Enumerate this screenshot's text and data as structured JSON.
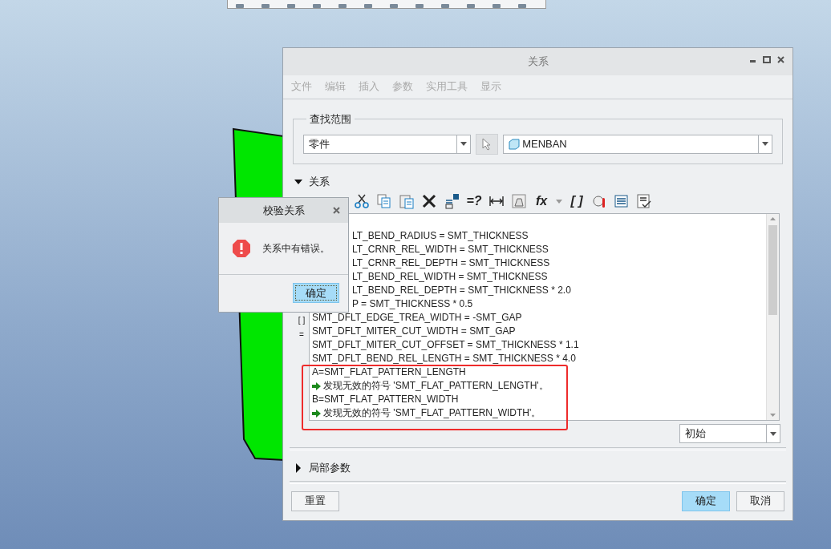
{
  "main_window": {
    "title": "关系",
    "menu": [
      {
        "label": "文件",
        "disabled": true
      },
      {
        "label": "编辑",
        "disabled": true
      },
      {
        "label": "插入",
        "disabled": true
      },
      {
        "label": "参数",
        "disabled": true
      },
      {
        "label": "实用工具",
        "disabled": true
      },
      {
        "label": "显示",
        "disabled": true
      }
    ],
    "scope": {
      "legend": "查找范围",
      "type_value": "零件",
      "object_value": "MENBAN"
    },
    "relations": {
      "heading": "关系",
      "expanded": true,
      "toolbar": [
        {
          "kind": "icon"
        },
        {
          "kind": "icon"
        },
        {
          "kind": "icon"
        },
        {
          "kind": "icon"
        },
        {
          "kind": "icon"
        },
        {
          "kind": "glyph",
          "label": "=?"
        },
        {
          "kind": "icon"
        },
        {
          "kind": "icon"
        },
        {
          "kind": "menu",
          "label": "fx"
        },
        {
          "kind": "glyph",
          "label": "[ ]"
        },
        {
          "kind": "icon"
        },
        {
          "kind": "icon"
        },
        {
          "kind": "icon"
        }
      ],
      "gutter": [
        "[ ]",
        "="
      ],
      "lines": [
        {
          "kind": "covered",
          "text": "LT_BEND_RADIUS = SMT_THICKNESS"
        },
        {
          "kind": "covered",
          "text": "LT_CRNR_REL_WIDTH = SMT_THICKNESS"
        },
        {
          "kind": "covered",
          "text": "LT_CRNR_REL_DEPTH = SMT_THICKNESS"
        },
        {
          "kind": "covered",
          "text": "LT_BEND_REL_WIDTH = SMT_THICKNESS"
        },
        {
          "kind": "covered",
          "text": "LT_BEND_REL_DEPTH = SMT_THICKNESS  * 2.0"
        },
        {
          "kind": "covered",
          "text": "P = SMT_THICKNESS  * 0.5"
        },
        {
          "kind": "code",
          "text": "SMT_DFLT_EDGE_TREA_WIDTH = -SMT_GAP"
        },
        {
          "kind": "code",
          "text": "SMT_DFLT_MITER_CUT_WIDTH = SMT_GAP"
        },
        {
          "kind": "code",
          "text": "SMT_DFLT_MITER_CUT_OFFSET = SMT_THICKNESS  * 1.1"
        },
        {
          "kind": "code",
          "text": "SMT_DFLT_BEND_REL_LENGTH = SMT_THICKNESS * 4.0"
        },
        {
          "kind": "code",
          "text": "A=SMT_FLAT_PATTERN_LENGTH"
        },
        {
          "kind": "error",
          "text": "发现无效的符号 'SMT_FLAT_PATTERN_LENGTH'。"
        },
        {
          "kind": "code",
          "text": "B=SMT_FLAT_PATTERN_WIDTH"
        },
        {
          "kind": "error",
          "text": "发现无效的符号 'SMT_FLAT_PATTERN_WIDTH'。"
        }
      ],
      "view_select": "初始"
    },
    "local_params": {
      "heading": "局部参数",
      "expanded": false
    },
    "buttons": [
      {
        "label": "重置",
        "primary": false
      },
      {
        "label": "确定",
        "primary": true
      },
      {
        "label": "取消",
        "primary": false
      }
    ]
  },
  "alert": {
    "title": "校验关系",
    "message": "关系中有错误。",
    "button": "确定"
  }
}
